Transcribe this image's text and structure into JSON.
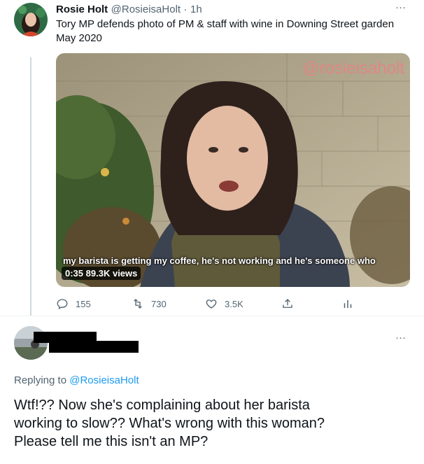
{
  "tweet": {
    "author_name": "Rosie Holt",
    "author_handle": "@RosieisaHolt",
    "separator": "·",
    "time": "1h",
    "more": "···",
    "text_line1": "Tory MP defends photo of PM & staff with wine in Downing Street garden",
    "text_line2": "May 2020",
    "video": {
      "watermark": "@rosieisaholt",
      "caption": "my barista is getting my coffee, he's not working and he's someone who",
      "duration": "0:35",
      "views": "89.3K views"
    },
    "actions": {
      "replies": "155",
      "retweets": "730",
      "likes": "3.5K"
    }
  },
  "reply": {
    "more": "···",
    "replying_prefix": "Replying to",
    "replying_handle": "@RosieisaHolt",
    "text_line1": "Wtf!?? Now she's complaining about her barista",
    "text_line2": "working to slow?? What's wrong with this woman?",
    "text_line3": "Please tell me this isn't an MP?"
  },
  "colors": {
    "accent": "#1d9bf0",
    "muted": "#536471",
    "text": "#0f1419"
  }
}
